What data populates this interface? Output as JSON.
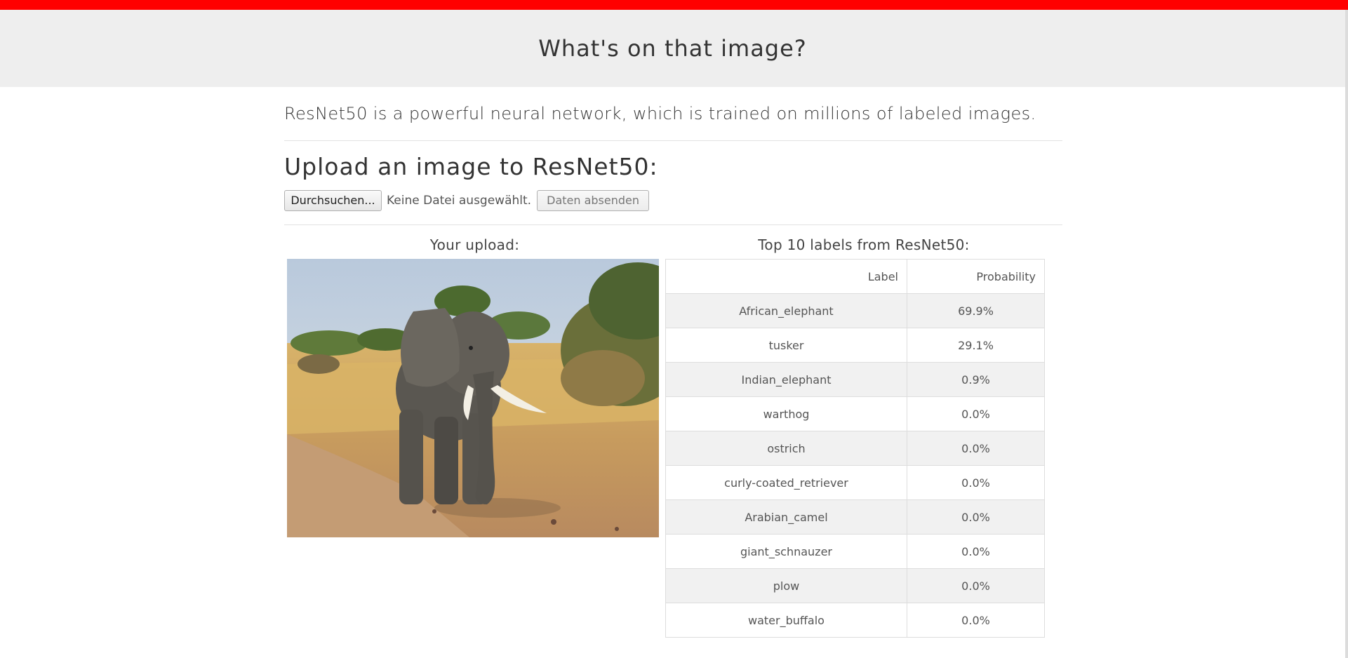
{
  "header": {
    "title": "What's on that image?"
  },
  "intro": {
    "text": "ResNet50 is a powerful neural network, which is trained on millions of labeled images."
  },
  "upload": {
    "title": "Upload an image to ResNet50:",
    "browse_label": "Durchsuchen...",
    "file_status": "Keine Datei ausgewählt.",
    "submit_label": "Daten absenden"
  },
  "results": {
    "upload_title": "Your upload:",
    "labels_title": "Top 10 labels from ResNet50:",
    "columns": [
      "Label",
      "Probability"
    ],
    "rows": [
      {
        "label": "African_elephant",
        "probability": "69.9%"
      },
      {
        "label": "tusker",
        "probability": "29.1%"
      },
      {
        "label": "Indian_elephant",
        "probability": "0.9%"
      },
      {
        "label": "warthog",
        "probability": "0.0%"
      },
      {
        "label": "ostrich",
        "probability": "0.0%"
      },
      {
        "label": "curly-coated_retriever",
        "probability": "0.0%"
      },
      {
        "label": "Arabian_camel",
        "probability": "0.0%"
      },
      {
        "label": "giant_schnauzer",
        "probability": "0.0%"
      },
      {
        "label": "plow",
        "probability": "0.0%"
      },
      {
        "label": "water_buffalo",
        "probability": "0.0%"
      }
    ]
  },
  "colors": {
    "topbar": "#ff0000",
    "header_bg": "#eeeeee"
  }
}
